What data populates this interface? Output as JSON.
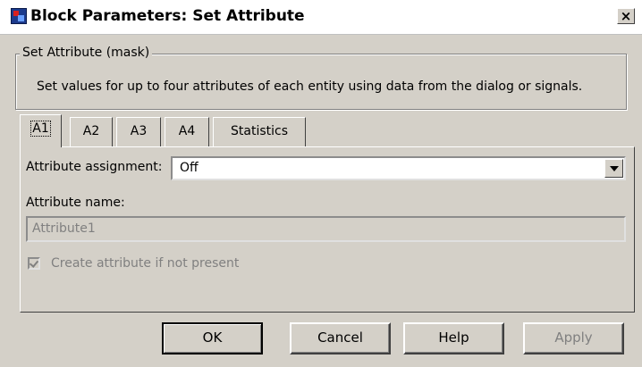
{
  "window": {
    "title": "Block Parameters: Set Attribute",
    "close_glyph": "×"
  },
  "mask": {
    "group_label": "Set Attribute (mask)",
    "description": "Set values for up to four attributes of each entity using data from the dialog or signals."
  },
  "tabs": [
    {
      "label": "A1",
      "active": true
    },
    {
      "label": "A2"
    },
    {
      "label": "A3"
    },
    {
      "label": "A4"
    },
    {
      "label": "Statistics"
    }
  ],
  "form": {
    "assignment_label": "Attribute assignment:",
    "assignment_value": "Off",
    "name_label": "Attribute name:",
    "name_value": "Attribute1",
    "checkbox_label": "Create attribute if not present",
    "checkbox_checked": true
  },
  "buttons": {
    "ok": "OK",
    "cancel": "Cancel",
    "help": "Help",
    "apply": "Apply"
  },
  "icons": {
    "app": "simulink-block-icon",
    "close": "close-icon",
    "dropdown": "chevron-down-icon"
  }
}
